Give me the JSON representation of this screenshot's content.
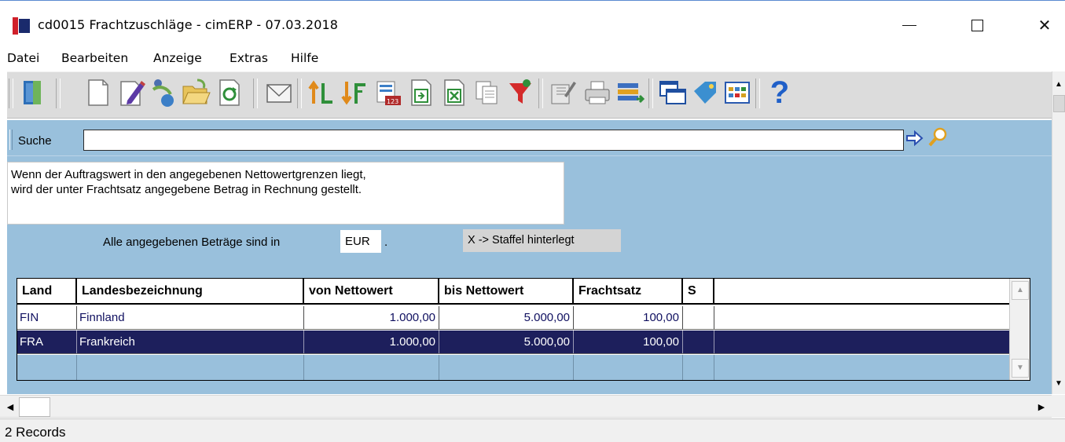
{
  "window": {
    "title": "cd0015 Frachtzuschläge - cimERP - 07.03.2018",
    "minimize_icon": "minimize-icon",
    "maximize_icon": "maximize-icon",
    "close_symbol": "✕"
  },
  "menu": [
    "Datei",
    "Bearbeiten",
    "Anzeige",
    "Extras",
    "Hilfe"
  ],
  "toolbar": {
    "icons": [
      "exit-door-icon",
      "new-document-icon",
      "edit-pencil-icon",
      "copy-record-icon",
      "open-folder-icon",
      "refresh-icon",
      "mail-icon",
      "sort-ascending-icon",
      "sort-descending-icon",
      "calculator-icon",
      "import-icon",
      "excel-export-icon",
      "duplicate-icon",
      "filter-funnel-icon",
      "properties-icon",
      "print-icon",
      "layout-icon",
      "windows-icon",
      "tag-icon",
      "calendar-grid-icon",
      "help-icon"
    ],
    "help_glyph": "?"
  },
  "search": {
    "label": "Suche",
    "value": "",
    "go_icon": "arrow-right-icon",
    "find_icon": "magnifier-icon"
  },
  "info": {
    "line1": "Wenn der Auftragswert in den angegebenen Nettowertgrenzen liegt,",
    "line2": "wird der unter Frachtsatz angegebene Betrag in Rechnung gestellt."
  },
  "currency": {
    "label": "Alle angegebenen Beträge sind in",
    "value": "EUR",
    "suffix": "."
  },
  "staffel_note": "X -> Staffel hinterlegt",
  "grid": {
    "columns": [
      "Land",
      "Landesbezeichnung",
      "von Nettowert",
      "bis Nettowert",
      "Frachtsatz",
      "S"
    ],
    "rows": [
      {
        "land": "FIN",
        "bezeichnung": "Finnland",
        "von": "1.000,00",
        "bis": "5.000,00",
        "frachtsatz": "100,00",
        "s": ""
      },
      {
        "land": "FRA",
        "bezeichnung": "Frankreich",
        "von": "1.000,00",
        "bis": "5.000,00",
        "frachtsatz": "100,00",
        "s": ""
      }
    ]
  },
  "status": "2 Records",
  "colors": {
    "panel": "#99c0dc",
    "selected_row": "#1d1f5c",
    "logo_red": "#d0202a",
    "logo_navy": "#1a2a6c"
  }
}
